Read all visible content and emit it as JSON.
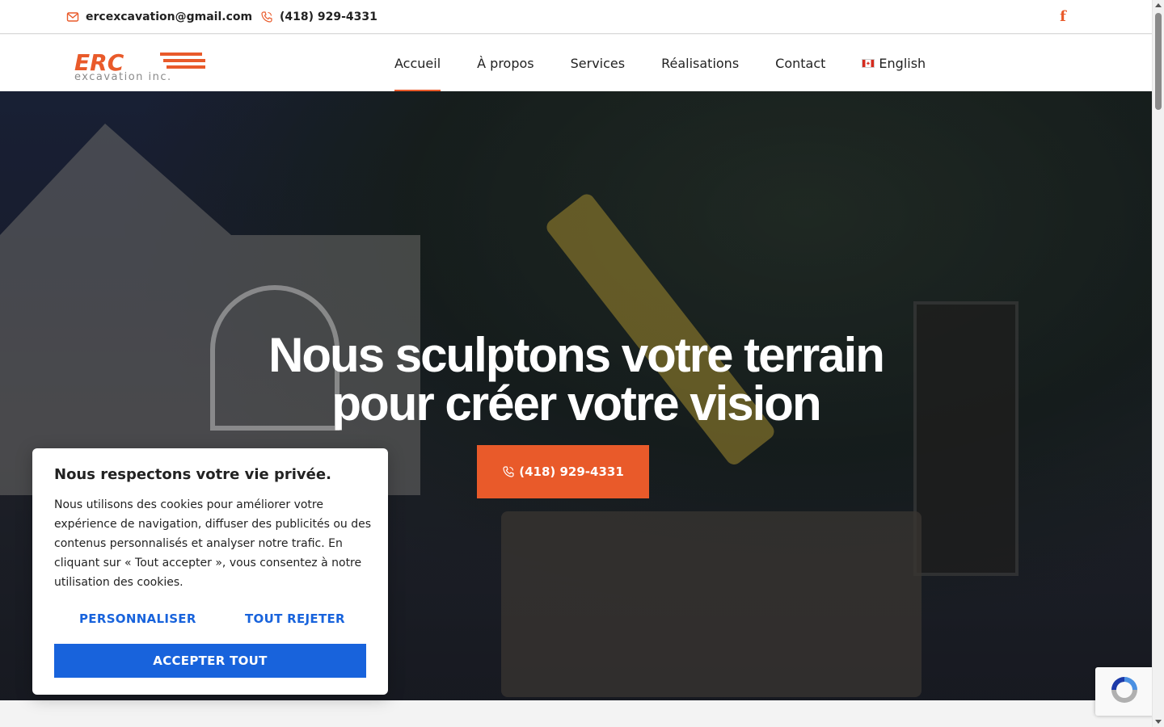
{
  "topbar": {
    "email": "ercexcavation@gmail.com",
    "phone": "(418) 929-4331",
    "social_icon": "facebook-icon"
  },
  "brand": {
    "logo_text": "ERC",
    "logo_subtext": "excavation inc.",
    "accent_color": "#e95a2a"
  },
  "nav": {
    "items": [
      {
        "label": "Accueil",
        "active": true
      },
      {
        "label": "À propos"
      },
      {
        "label": "Services"
      },
      {
        "label": "Réalisations"
      },
      {
        "label": "Contact"
      }
    ],
    "language": "English"
  },
  "hero": {
    "title_line1": "Nous sculptons votre terrain",
    "title_line2": "pour créer votre vision",
    "cta_label": "(418) 929-4331"
  },
  "cookie": {
    "title": "Nous respectons votre vie privée.",
    "body": "Nous utilisons des cookies pour améliorer votre expérience de navigation, diffuser des publicités ou des contenus personnalisés et analyser notre trafic. En cliquant sur « Tout accepter », vous consentez à notre utilisation des cookies.",
    "customize_label": "PERSONNALISER",
    "reject_label": "TOUT REJETER",
    "accept_label": "ACCEPTER TOUT",
    "button_color": "#1863dc"
  }
}
